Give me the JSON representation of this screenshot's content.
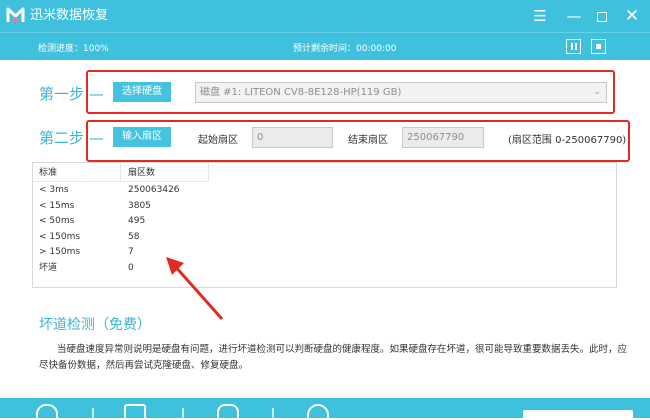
{
  "window": {
    "title": "迅米数据恢复"
  },
  "progress": {
    "label": "检测进度：100%",
    "value": 100,
    "eta": "预计剩余时间：00:00:00"
  },
  "step1": {
    "label": "第一步",
    "button": "选择硬盘",
    "disk_selected": "磁盘 #1: LITEON CV8-8E128-HP(119 GB)"
  },
  "step2": {
    "label": "第二步",
    "button": "输入扇区",
    "start_label": "起始扇区",
    "start_value": "0",
    "end_label": "结束扇区",
    "end_value": "250067790",
    "range_text": "(扇区范围 0-250067790)"
  },
  "table": {
    "headers": [
      "标准",
      "扇区数"
    ],
    "rows": [
      [
        "< 3ms",
        "250063426"
      ],
      [
        "< 15ms",
        "3805"
      ],
      [
        "< 50ms",
        "495"
      ],
      [
        "< 150ms",
        "58"
      ],
      [
        "> 150ms",
        "7"
      ],
      [
        "坏道",
        "0"
      ]
    ]
  },
  "bad_sector": {
    "title": "坏道检测（免费）",
    "description": "当硬盘速度异常则说明是硬盘有问题，进行坏道检测可以判断硬盘的健康程度。如果硬盘存在坏道，很可能导致重要数据丢失。此时，应尽快备份数据，然后再尝试克隆硬盘、修复硬盘。"
  },
  "colors": {
    "accent": "#3fc1dd",
    "annotation_red": "#e02a24",
    "step_text": "#39b7d6"
  },
  "icons": [
    "logo-icon",
    "menu-icon",
    "minimize-icon",
    "maximize-icon",
    "close-icon",
    "pause-icon",
    "stop-icon",
    "dropdown-chevron-icon"
  ]
}
